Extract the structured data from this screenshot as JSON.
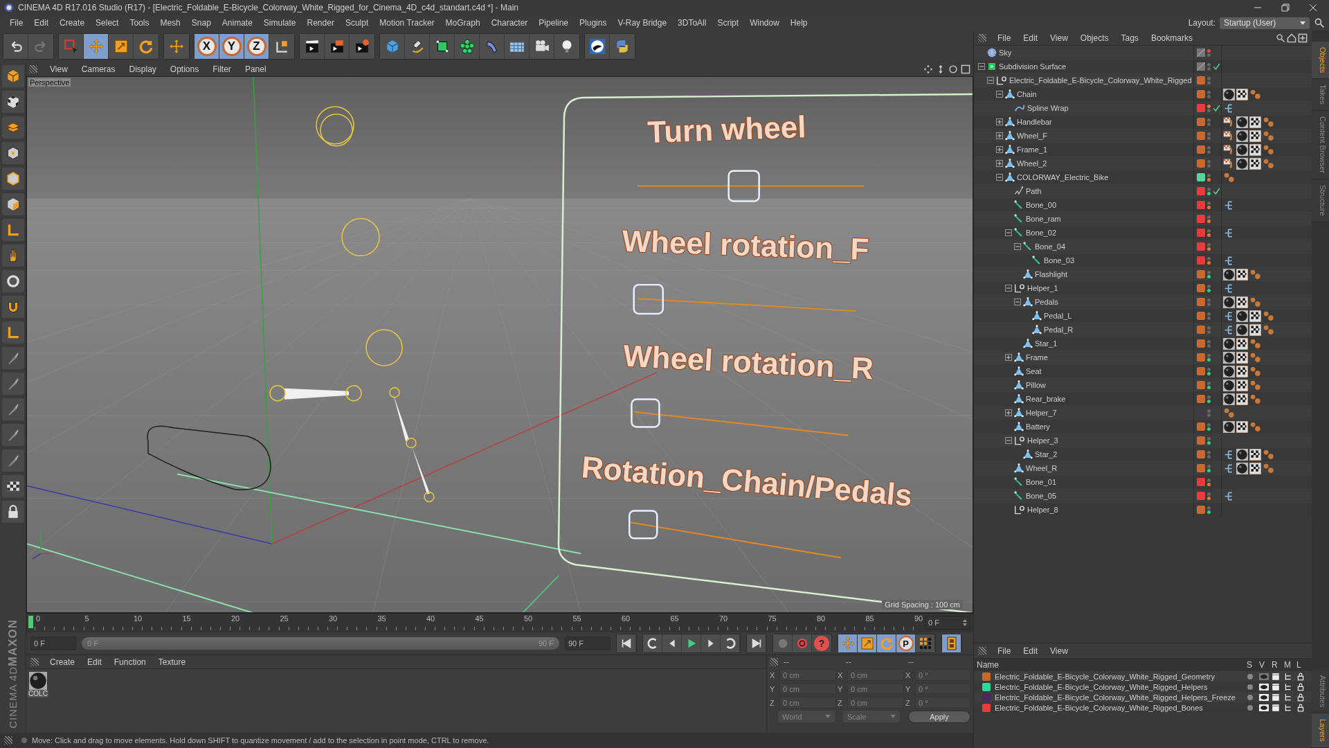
{
  "window": {
    "title": "CINEMA 4D R17.016 Studio (R17) - [Electric_Foldable_E-Bicycle_Colorway_White_Rigged_for_Cinema_4D_c4d_standart.c4d *] - Main"
  },
  "menu": [
    "File",
    "Edit",
    "Create",
    "Select",
    "Tools",
    "Mesh",
    "Snap",
    "Animate",
    "Simulate",
    "Render",
    "Sculpt",
    "Motion Tracker",
    "MoGraph",
    "Character",
    "Pipeline",
    "Plugins",
    "V-Ray Bridge",
    "3DToAll",
    "Script",
    "Window",
    "Help"
  ],
  "layout": {
    "label": "Layout:",
    "value": "Startup (User)"
  },
  "toolbar": {
    "tools": [
      {
        "kind": "select",
        "selected": false
      },
      {
        "kind": "move",
        "selected": true
      },
      {
        "kind": "scale",
        "selected": false
      },
      {
        "kind": "rotate",
        "selected": false
      },
      {
        "kind": "move",
        "selected": false
      }
    ],
    "axes": [
      {
        "label": "X",
        "selected": true
      },
      {
        "label": "Y",
        "selected": true
      },
      {
        "label": "Z",
        "selected": true
      }
    ]
  },
  "viewport": {
    "menu": [
      "View",
      "Cameras",
      "Display",
      "Options",
      "Filter",
      "Panel"
    ],
    "camera": "Perspective",
    "grid_spacing": "Grid Spacing : 100 cm",
    "controls": [
      {
        "label": "Turn wheel",
        "level": 0.47
      },
      {
        "label": "Wheel rotation_F",
        "level": 0.05
      },
      {
        "label": "Wheel rotation_R",
        "level": 0.05
      },
      {
        "label": "Rotation_Chain/Pedals",
        "level": 0.06
      }
    ]
  },
  "timeline": {
    "ticks": [
      "0",
      "5",
      "10",
      "15",
      "20",
      "25",
      "30",
      "35",
      "40",
      "45",
      "50",
      "55",
      "60",
      "65",
      "70",
      "75",
      "80",
      "85",
      "90"
    ],
    "current": "0 F",
    "start": "0 F",
    "range": {
      "start": "0 F",
      "end": "90 F"
    },
    "end": "90 F"
  },
  "key_buttons": [
    {
      "kind": "move",
      "selected": true
    },
    {
      "kind": "scale",
      "selected": true
    },
    {
      "kind": "rotate",
      "selected": true
    },
    {
      "kind": "param",
      "label": "P",
      "selected": true
    },
    {
      "kind": "points",
      "selected": false
    }
  ],
  "help_button": "?",
  "materials": {
    "menu": [
      "Create",
      "Edit",
      "Function",
      "Texture"
    ],
    "items": [
      {
        "name": "COLC"
      }
    ]
  },
  "coordinates": {
    "headers": [
      "--",
      "--",
      "--"
    ],
    "rows": [
      {
        "axis": "X",
        "position": "0 cm",
        "size_axis": "X",
        "size": "0 cm",
        "rot_axis": "X",
        "rotation": "0 °"
      },
      {
        "axis": "Y",
        "position": "0 cm",
        "size_axis": "Y",
        "size": "0 cm",
        "rot_axis": "Y",
        "rotation": "0 °"
      },
      {
        "axis": "Z",
        "position": "0 cm",
        "size_axis": "Z",
        "size": "0 cm",
        "rot_axis": "Z",
        "rotation": "0 °"
      }
    ],
    "space": "World",
    "mode": "Scale",
    "apply": "Apply"
  },
  "logo": [
    "MAXON",
    "CINEMA 4D"
  ],
  "status_bar": "Move: Click and drag to move elements. Hold down SHIFT to quantize movement / add to the selection in point mode, CTRL to remove.",
  "objects_menu": [
    "File",
    "Edit",
    "View",
    "Objects",
    "Tags",
    "Bookmarks"
  ],
  "objects": [
    {
      "name": "Sky",
      "kind": "sky",
      "dots": [
        {
          "color": "#e84848"
        },
        {
          "color": "#666666"
        }
      ],
      "checked": false
    },
    {
      "name": "Subdivision Surface",
      "kind": "subdivision",
      "dots": [
        {
          "color": "#666666"
        },
        {
          "color": "#666666"
        }
      ],
      "checked": true,
      "expanded": true,
      "children": [
        {
          "name": "Electric_Foldable_E-Bicycle_Colorway_White_Rigged",
          "kind": "null",
          "color": "#c8682e",
          "dots": [
            {
              "color": "#666666"
            },
            {
              "color": "#666666"
            }
          ],
          "checked": false,
          "expanded": true,
          "children": [
            {
              "name": "Chain",
              "kind": "polygon",
              "color": "#c8682e",
              "dots": [
                {
                  "color": "#666666"
                },
                {
                  "color": "#666666"
                }
              ],
              "checked": false,
              "expanded": true,
              "tags": [
                {
                  "kind": "material"
                },
                {
                  "kind": "checker"
                },
                {
                  "kind": "dots"
                }
              ],
              "children": [
                {
                  "name": "Spline Wrap",
                  "kind": "deformer",
                  "color": "#e83c3c",
                  "dots": [
                    {
                      "color": "#e07a30"
                    },
                    {
                      "color": "#666666"
                    }
                  ],
                  "checked": true,
                  "tags": [
                    {
                      "kind": "branch"
                    }
                  ]
                }
              ]
            },
            {
              "name": "Handlebar",
              "kind": "polygon",
              "color": "#c8682e",
              "dots": [
                {
                  "color": "#666666"
                },
                {
                  "color": "#666666"
                }
              ],
              "checked": false,
              "expanded": false,
              "tags": [
                {
                  "kind": "weight"
                },
                {
                  "kind": "material"
                },
                {
                  "kind": "checker"
                },
                {
                  "kind": "dots"
                }
              ]
            },
            {
              "name": "Wheel_F",
              "kind": "polygon",
              "color": "#c8682e",
              "dots": [
                {
                  "color": "#666666"
                },
                {
                  "color": "#666666"
                }
              ],
              "checked": false,
              "expanded": false,
              "tags": [
                {
                  "kind": "weight"
                },
                {
                  "kind": "material"
                },
                {
                  "kind": "checker"
                },
                {
                  "kind": "dots"
                }
              ]
            },
            {
              "name": "Frame_1",
              "kind": "polygon",
              "color": "#c8682e",
              "dots": [
                {
                  "color": "#666666"
                },
                {
                  "color": "#666666"
                }
              ],
              "checked": false,
              "expanded": false,
              "tags": [
                {
                  "kind": "weight"
                },
                {
                  "kind": "material"
                },
                {
                  "kind": "checker"
                },
                {
                  "kind": "dots"
                }
              ]
            },
            {
              "name": "Wheel_2",
              "kind": "polygon",
              "color": "#c8682e",
              "dots": [
                {
                  "color": "#666666"
                },
                {
                  "color": "#666666"
                }
              ],
              "checked": false,
              "expanded": false,
              "tags": [
                {
                  "kind": "weight"
                },
                {
                  "kind": "material"
                },
                {
                  "kind": "checker"
                },
                {
                  "kind": "dots"
                }
              ]
            },
            {
              "name": "COLORWAY_Electric_Bike",
              "kind": "polygon",
              "color": "#4ed89b",
              "dots": [
                {
                  "color": "#666666"
                },
                {
                  "color": "#e07a30"
                }
              ],
              "checked": false,
              "expanded": true,
              "tags": [
                {
                  "kind": "dots"
                }
              ],
              "children": [
                {
                  "name": "Path",
                  "kind": "spline",
                  "color": "#e83c3c",
                  "dots": [
                    {
                      "color": "#666666"
                    },
                    {
                      "color": "#30d080"
                    }
                  ],
                  "checked": true
                },
                {
                  "name": "Bone_00",
                  "kind": "bone",
                  "color": "#e83c3c",
                  "dots": [
                    {
                      "color": "#666666"
                    },
                    {
                      "color": "#e07a30"
                    }
                  ],
                  "checked": false,
                  "tags": [
                    {
                      "kind": "branch"
                    }
                  ]
                },
                {
                  "name": "Bone_ram",
                  "kind": "bone",
                  "color": "#e83c3c",
                  "dots": [
                    {
                      "color": "#666666"
                    },
                    {
                      "color": "#e07a30"
                    }
                  ],
                  "checked": false
                },
                {
                  "name": "Bone_02",
                  "kind": "bone",
                  "color": "#e83c3c",
                  "dots": [
                    {
                      "color": "#666666"
                    },
                    {
                      "color": "#e07a30"
                    }
                  ],
                  "checked": false,
                  "expanded": true,
                  "tags": [
                    {
                      "kind": "branch"
                    }
                  ],
                  "children": [
                    {
                      "name": "Bone_04",
                      "kind": "bone",
                      "color": "#e83c3c",
                      "dots": [
                        {
                          "color": "#666666"
                        },
                        {
                          "color": "#e07a30"
                        }
                      ],
                      "checked": false,
                      "expanded": true,
                      "children": [
                        {
                          "name": "Bone_03",
                          "kind": "bone",
                          "color": "#e83c3c",
                          "dots": [
                            {
                              "color": "#666666"
                            },
                            {
                              "color": "#e07a30"
                            }
                          ],
                          "checked": false,
                          "tags": [
                            {
                              "kind": "branch"
                            }
                          ]
                        }
                      ]
                    },
                    {
                      "name": "Flashlight",
                      "kind": "polygon",
                      "color": "#c8682e",
                      "dots": [
                        {
                          "color": "#666666"
                        },
                        {
                          "color": "#30d080"
                        }
                      ],
                      "checked": false,
                      "tags": [
                        {
                          "kind": "material"
                        },
                        {
                          "kind": "checker"
                        },
                        {
                          "kind": "dots"
                        }
                      ]
                    }
                  ]
                },
                {
                  "name": "Helper_1",
                  "kind": "null",
                  "color": "#c8682e",
                  "dots": [
                    {
                      "color": "#666666"
                    },
                    {
                      "color": "#30d080"
                    }
                  ],
                  "checked": false,
                  "expanded": true,
                  "tags": [
                    {
                      "kind": "branch"
                    }
                  ],
                  "children": [
                    {
                      "name": "Pedals",
                      "kind": "polygon",
                      "color": "#c8682e",
                      "dots": [
                        {
                          "color": "#666666"
                        },
                        {
                          "color": "#666666"
                        }
                      ],
                      "checked": false,
                      "expanded": true,
                      "tags": [
                        {
                          "kind": "material"
                        },
                        {
                          "kind": "checker"
                        },
                        {
                          "kind": "dots"
                        }
                      ],
                      "children": [
                        {
                          "name": "Pedal_L",
                          "kind": "polygon",
                          "color": "#c8682e",
                          "dots": [
                            {
                              "color": "#666666"
                            },
                            {
                              "color": "#666666"
                            }
                          ],
                          "checked": false,
                          "tags": [
                            {
                              "kind": "branch"
                            },
                            {
                              "kind": "material"
                            },
                            {
                              "kind": "checker"
                            },
                            {
                              "kind": "dots"
                            }
                          ]
                        },
                        {
                          "name": "Pedal_R",
                          "kind": "polygon",
                          "color": "#c8682e",
                          "dots": [
                            {
                              "color": "#666666"
                            },
                            {
                              "color": "#666666"
                            }
                          ],
                          "checked": false,
                          "tags": [
                            {
                              "kind": "branch"
                            },
                            {
                              "kind": "material"
                            },
                            {
                              "kind": "checker"
                            },
                            {
                              "kind": "dots"
                            }
                          ]
                        }
                      ]
                    },
                    {
                      "name": "Star_1",
                      "kind": "polygon",
                      "color": "#c8682e",
                      "dots": [
                        {
                          "color": "#666666"
                        },
                        {
                          "color": "#666666"
                        }
                      ],
                      "checked": false,
                      "tags": [
                        {
                          "kind": "material"
                        },
                        {
                          "kind": "checker"
                        },
                        {
                          "kind": "dots"
                        }
                      ]
                    }
                  ]
                },
                {
                  "name": "Frame",
                  "kind": "polygon",
                  "color": "#c8682e",
                  "dots": [
                    {
                      "color": "#666666"
                    },
                    {
                      "color": "#30d080"
                    }
                  ],
                  "checked": false,
                  "expanded": false,
                  "tags": [
                    {
                      "kind": "material"
                    },
                    {
                      "kind": "checker"
                    },
                    {
                      "kind": "dots"
                    }
                  ]
                },
                {
                  "name": "Seat",
                  "kind": "polygon",
                  "color": "#c8682e",
                  "dots": [
                    {
                      "color": "#666666"
                    },
                    {
                      "color": "#30d080"
                    }
                  ],
                  "checked": false,
                  "tags": [
                    {
                      "kind": "material"
                    },
                    {
                      "kind": "checker"
                    },
                    {
                      "kind": "dots"
                    }
                  ]
                },
                {
                  "name": "Pillow",
                  "kind": "polygon",
                  "color": "#c8682e",
                  "dots": [
                    {
                      "color": "#666666"
                    },
                    {
                      "color": "#30d080"
                    }
                  ],
                  "checked": false,
                  "tags": [
                    {
                      "kind": "material"
                    },
                    {
                      "kind": "checker"
                    },
                    {
                      "kind": "dots"
                    }
                  ]
                },
                {
                  "name": "Rear_brake",
                  "kind": "polygon",
                  "color": "#c8682e",
                  "dots": [
                    {
                      "color": "#666666"
                    },
                    {
                      "color": "#30d080"
                    }
                  ],
                  "checked": false,
                  "tags": [
                    {
                      "kind": "material"
                    },
                    {
                      "kind": "checker"
                    },
                    {
                      "kind": "dots"
                    }
                  ]
                },
                {
                  "name": "Helper_7",
                  "kind": "polygon",
                  "color": "#3e3a48",
                  "dots": [
                    {
                      "color": "#666666"
                    },
                    {
                      "color": "#666666"
                    }
                  ],
                  "checked": false,
                  "expanded": false,
                  "tags": [
                    {
                      "kind": "dots"
                    }
                  ]
                },
                {
                  "name": "Battery",
                  "kind": "polygon",
                  "color": "#c8682e",
                  "dots": [
                    {
                      "color": "#666666"
                    },
                    {
                      "color": "#30d080"
                    }
                  ],
                  "checked": false,
                  "tags": [
                    {
                      "kind": "material"
                    },
                    {
                      "kind": "checker"
                    },
                    {
                      "kind": "dots"
                    }
                  ]
                },
                {
                  "name": "Helper_3",
                  "kind": "null",
                  "color": "#c8682e",
                  "dots": [
                    {
                      "color": "#666666"
                    },
                    {
                      "color": "#30d080"
                    }
                  ],
                  "checked": false,
                  "expanded": true,
                  "children": [
                    {
                      "name": "Star_2",
                      "kind": "polygon",
                      "color": "#c8682e",
                      "dots": [
                        {
                          "color": "#666666"
                        },
                        {
                          "color": "#666666"
                        }
                      ],
                      "checked": false,
                      "tags": [
                        {
                          "kind": "branch"
                        },
                        {
                          "kind": "material"
                        },
                        {
                          "kind": "checker"
                        },
                        {
                          "kind": "dots"
                        }
                      ]
                    }
                  ]
                },
                {
                  "name": "Wheel_R",
                  "kind": "polygon",
                  "color": "#c8682e",
                  "dots": [
                    {
                      "color": "#666666"
                    },
                    {
                      "color": "#30d080"
                    }
                  ],
                  "checked": false,
                  "tags": [
                    {
                      "kind": "branch"
                    },
                    {
                      "kind": "material"
                    },
                    {
                      "kind": "checker"
                    },
                    {
                      "kind": "dots"
                    }
                  ]
                },
                {
                  "name": "Bone_01",
                  "kind": "bone",
                  "color": "#e83c3c",
                  "dots": [
                    {
                      "color": "#666666"
                    },
                    {
                      "color": "#e07a30"
                    }
                  ],
                  "checked": false
                },
                {
                  "name": "Bone_05",
                  "kind": "bone",
                  "color": "#e83c3c",
                  "dots": [
                    {
                      "color": "#666666"
                    },
                    {
                      "color": "#e07a30"
                    }
                  ],
                  "checked": false,
                  "tags": [
                    {
                      "kind": "branch"
                    }
                  ]
                },
                {
                  "name": "Helper_8",
                  "kind": "null",
                  "color": "#c8682e",
                  "dots": [
                    {
                      "color": "#666666"
                    },
                    {
                      "color": "#30d080"
                    }
                  ],
                  "checked": false
                }
              ]
            }
          ]
        }
      ]
    }
  ],
  "layers_menu": [
    "File",
    "Edit",
    "View"
  ],
  "layers_columns": [
    "Name",
    "S",
    "V",
    "R",
    "M",
    "L"
  ],
  "layers": [
    {
      "name": "Electric_Foldable_E-Bicycle_Colorway_White_Rigged_Geometry",
      "color": "#c8682e",
      "visible": false
    },
    {
      "name": "Electric_Foldable_E-Bicycle_Colorway_White_Rigged_Helpers",
      "color": "#2fd896",
      "visible": true
    },
    {
      "name": "Electric_Foldable_E-Bicycle_Colorway_White_Rigged_Helpers_Freeze",
      "color": "#4a2a5c",
      "visible": true
    },
    {
      "name": "Electric_Foldable_E-Bicycle_Colorway_White_Rigged_Bones",
      "color": "#e83c3c",
      "visible": true
    }
  ],
  "side_tabs_top": [
    {
      "label": "Objects",
      "selected": true
    },
    {
      "label": "Takes",
      "selected": false
    },
    {
      "label": "Content Browser",
      "selected": false
    },
    {
      "label": "Structure",
      "selected": false
    }
  ],
  "side_tabs_bottom": [
    {
      "label": "Attributes",
      "selected": false
    },
    {
      "label": "Layers",
      "selected": true
    }
  ]
}
